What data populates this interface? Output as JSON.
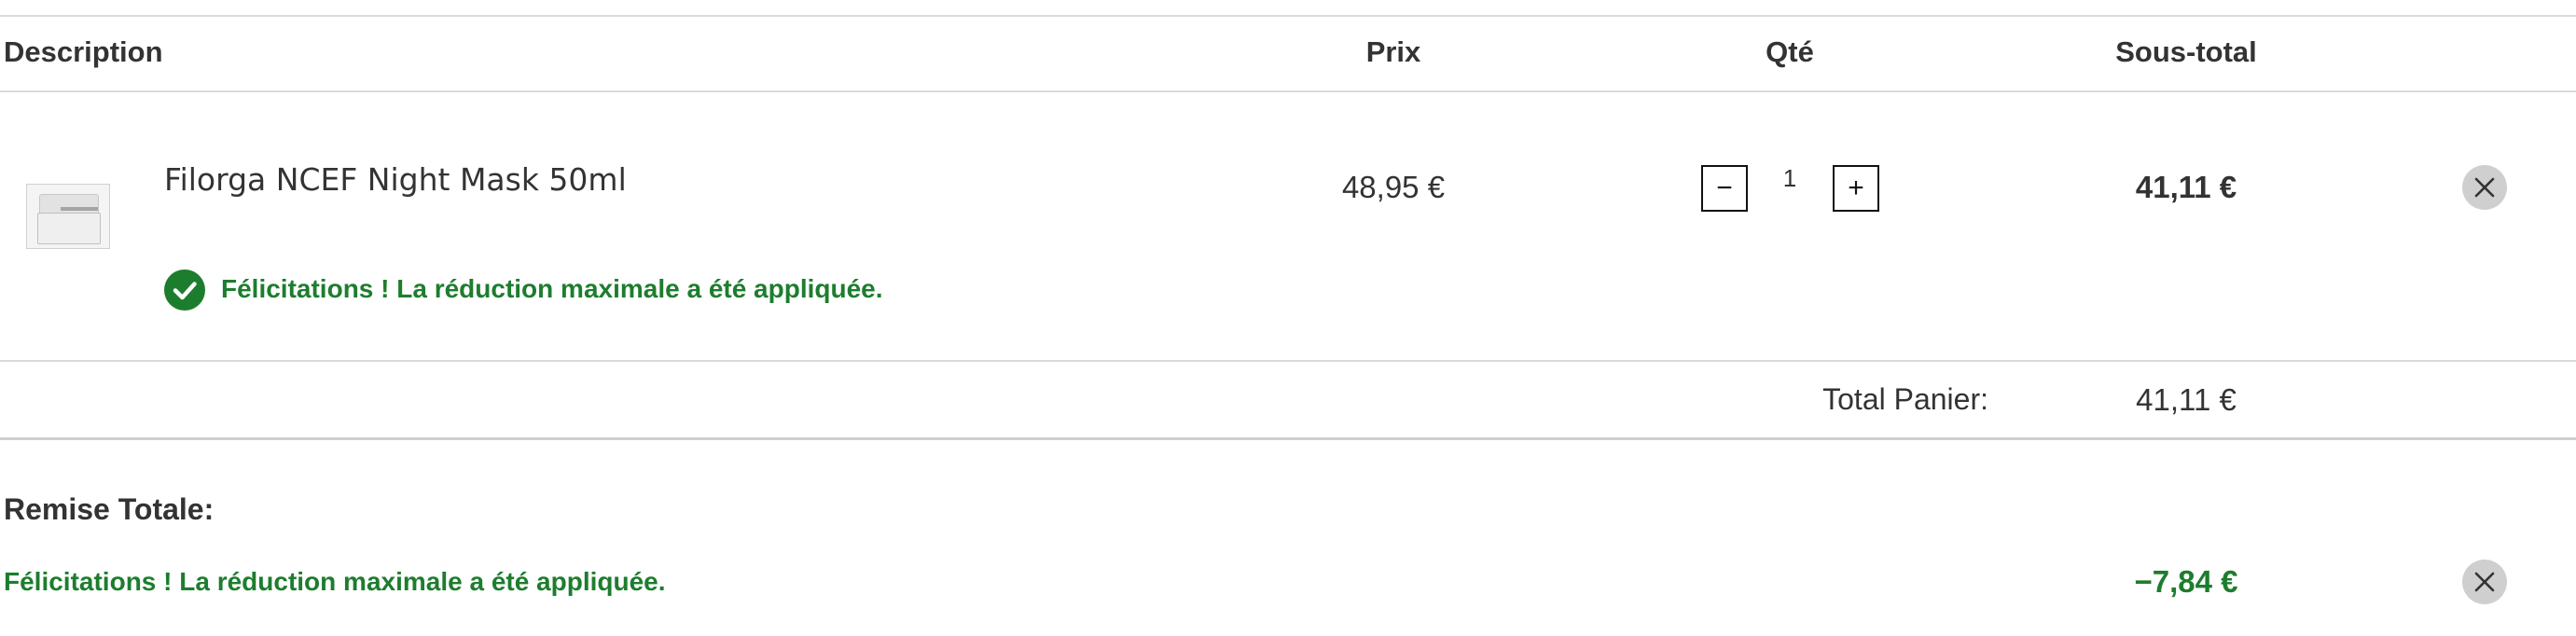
{
  "table": {
    "headers": {
      "description": "Description",
      "price": "Prix",
      "quantity": "Qté",
      "subtotal": "Sous-total"
    }
  },
  "item": {
    "name": "Filorga NCEF Night Mask 50ml",
    "price": "48,95 €",
    "quantity": "1",
    "decrement_label": "−",
    "increment_label": "+",
    "subtotal": "41,11 €",
    "discount_message": "Félicitations ! La réduction maximale a été appliquée.",
    "thumbnail_icon": "product-jar-icon"
  },
  "totals": {
    "label": "Total Panier:",
    "value": "41,11 €"
  },
  "discount": {
    "title": "Remise Totale:",
    "message": "Félicitations ! La réduction maximale a été appliquée.",
    "amount": "−7,84 €"
  },
  "colors": {
    "success": "#1d7d2e",
    "remove_button_bg": "#cfcfcf",
    "divider": "#dadada"
  }
}
